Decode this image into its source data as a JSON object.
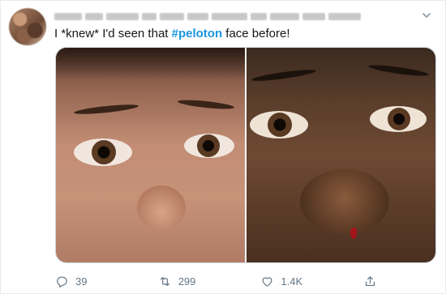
{
  "tweet": {
    "text_before": "I *knew* I'd seen that ",
    "hashtag": "#peloton",
    "text_after": " face before!",
    "more_icon": "chevron-down-icon"
  },
  "actions": {
    "replies": "39",
    "retweets": "299",
    "likes": "1.4K"
  },
  "colors": {
    "hashtag": "#1b95e0",
    "text": "#14171a",
    "muted": "#657786",
    "border": "#e6ecf0"
  }
}
